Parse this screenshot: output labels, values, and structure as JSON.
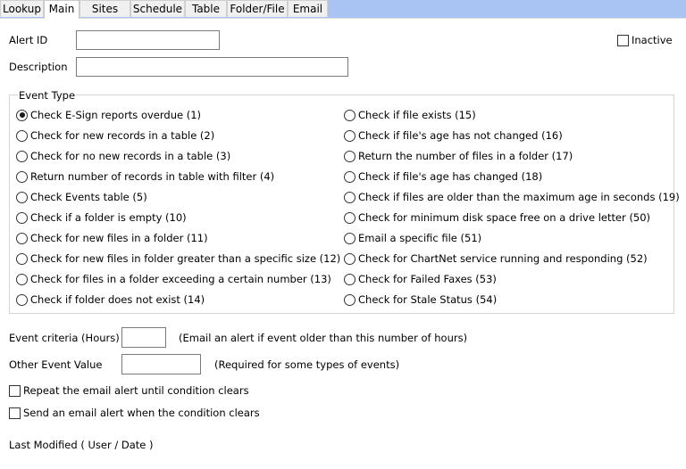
{
  "tabs": [
    {
      "label": "Lookup"
    },
    {
      "label": "Main"
    },
    {
      "label": "Sites"
    },
    {
      "label": "Schedule"
    },
    {
      "label": "Table"
    },
    {
      "label": "Folder/File"
    },
    {
      "label": "Email"
    }
  ],
  "active_tab": "Main",
  "form": {
    "alert_id_label": "Alert ID",
    "alert_id_value": "",
    "description_label": "Description",
    "description_value": "",
    "inactive_label": "Inactive",
    "inactive_checked": false
  },
  "event_type": {
    "legend": "Event Type",
    "selected_index": 0,
    "left_options": [
      "Check E-Sign reports overdue (1)",
      "Check for new records in a table (2)",
      "Check for no new records in a table (3)",
      "Return number of records in table with filter (4)",
      "Check Events table (5)",
      "Check if a folder is empty (10)",
      "Check for new files in a folder (11)",
      "Check for new files in folder greater than a specific size (12)",
      "Check for files in a folder exceeding a certain number (13)",
      "Check if folder does not exist (14)"
    ],
    "right_options": [
      "Check if file exists (15)",
      "Check if file's age has not changed (16)",
      "Return the number of files in a folder (17)",
      "Check if file's age has changed (18)",
      "Check if files are older than the maximum age in seconds (19)",
      "Check for minimum disk space free on a drive letter (50)",
      "Email a specific file (51)",
      "Check for ChartNet service running and responding (52)",
      "Check for Failed Faxes (53)",
      "Check for Stale Status (54)"
    ]
  },
  "criteria": {
    "hours_label": "Event criteria (Hours)",
    "hours_value": "",
    "hours_hint": "(Email an alert if event older than this number of hours)",
    "other_label": "Other Event Value",
    "other_value": "",
    "other_hint": "(Required for some types of events)"
  },
  "options": {
    "repeat_label": "Repeat the email alert until condition clears",
    "repeat_checked": false,
    "send_clear_label": "Send an email alert when the condition clears",
    "send_clear_checked": false
  },
  "footer": {
    "last_modified_label": "Last Modified ( User / Date )"
  }
}
